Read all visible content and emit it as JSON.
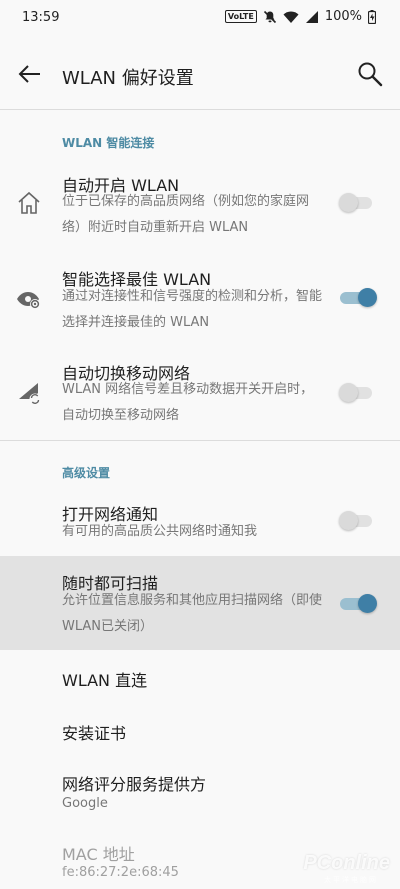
{
  "status_bar": {
    "time": "13:59",
    "volte": "VoLTE",
    "battery": "100%"
  },
  "header": {
    "title": "WLAN 偏好设置"
  },
  "sections": {
    "smart_connect": "WLAN 智能连接",
    "advanced": "高级设置"
  },
  "settings": {
    "auto_on": {
      "title": "自动开启 WLAN",
      "summary": "位于已保存的高品质网络（例如您的家庭网络）附近时自动重新开启 WLAN",
      "enabled": false
    },
    "smart_select": {
      "title": "智能选择最佳 WLAN",
      "summary": "通过对连接性和信号强度的检测和分析，智能选择并连接最佳的 WLAN",
      "enabled": true
    },
    "auto_switch": {
      "title": "自动切换移动网络",
      "summary": "WLAN 网络信号差且移动数据开关开启时，自动切换至移动网络",
      "enabled": false
    },
    "network_notify": {
      "title": "打开网络通知",
      "summary": "有可用的高品质公共网络时通知我",
      "enabled": false
    },
    "always_scan": {
      "title": "随时都可扫描",
      "summary": "允许位置信息服务和其他应用扫描网络（即使WLAN已关闭）",
      "enabled": true
    },
    "wlan_direct": {
      "title": "WLAN 直连"
    },
    "install_cert": {
      "title": "安装证书"
    },
    "rating_provider": {
      "title": "网络评分服务提供方",
      "value": "Google"
    },
    "mac": {
      "title": "MAC 地址",
      "value": "fe:86:27:2e:68:45"
    }
  },
  "watermark": {
    "brand": "PConline",
    "sub": "太平洋电脑网"
  },
  "colors": {
    "accent": "#3f7fa6",
    "section_header": "#4e8ba4",
    "highlight_row": "#e2e2e2"
  }
}
